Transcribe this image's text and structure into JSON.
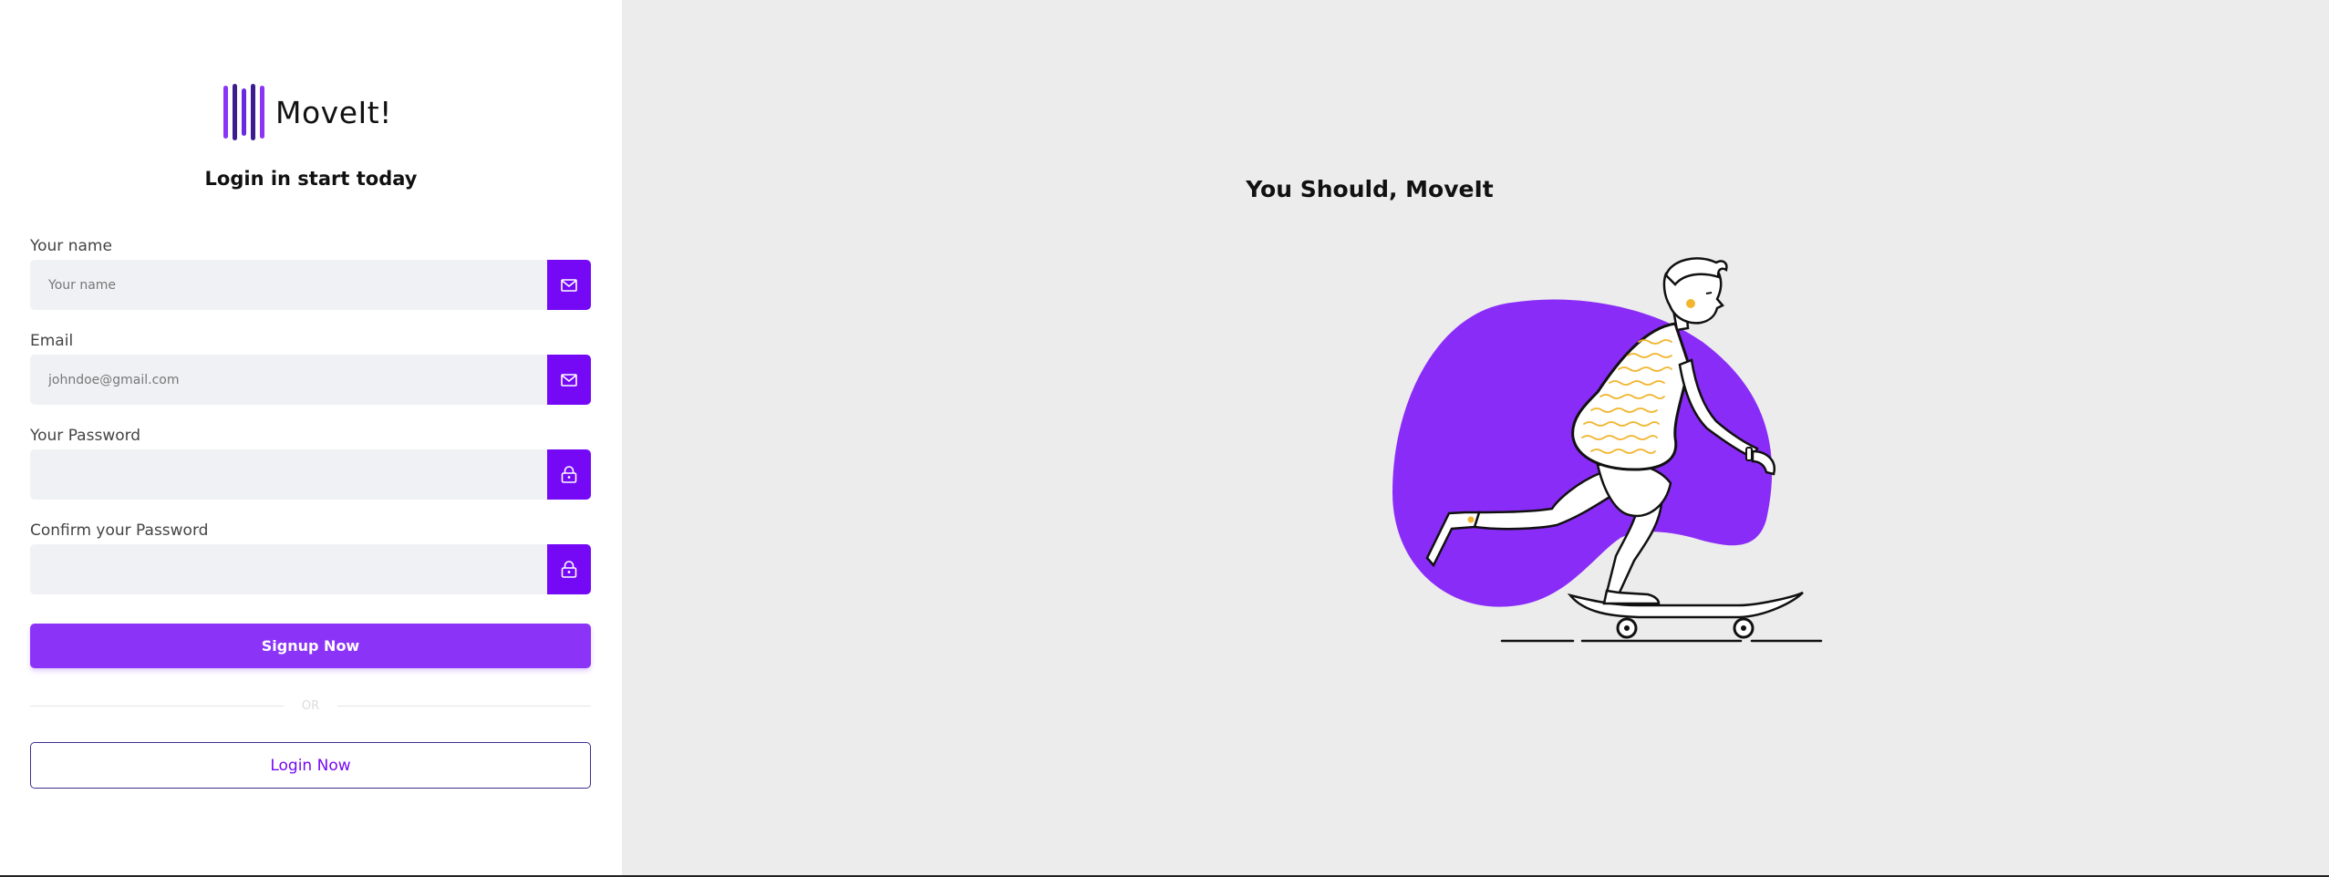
{
  "brand": {
    "name": "MoveIt!",
    "bar_colors": [
      "#8b34f7",
      "#3b1d8f",
      "#6a2be0",
      "#3b1d8f",
      "#8b34f7"
    ]
  },
  "form": {
    "subtitle": "Login in start today",
    "fields": [
      {
        "label": "Your name",
        "placeholder": "Your name",
        "value": "",
        "icon": "mail-icon"
      },
      {
        "label": "Email",
        "placeholder": "johndoe@gmail.com",
        "value": "",
        "icon": "mail-icon"
      },
      {
        "label": "Your Password",
        "placeholder": "",
        "value": "",
        "icon": "lock-icon"
      },
      {
        "label": "Confirm your Password",
        "placeholder": "",
        "value": "",
        "icon": "lock-icon"
      }
    ],
    "signup_label": "Signup Now",
    "divider_text": "OR",
    "login_label": "Login Now"
  },
  "hero": {
    "tagline": "You Should, MoveIt"
  },
  "colors": {
    "accent": "#7509f6",
    "button": "#8b34f7",
    "blob": "#8a2cf7",
    "stripes": "#f2b530",
    "panel_bg": "#ececec"
  }
}
